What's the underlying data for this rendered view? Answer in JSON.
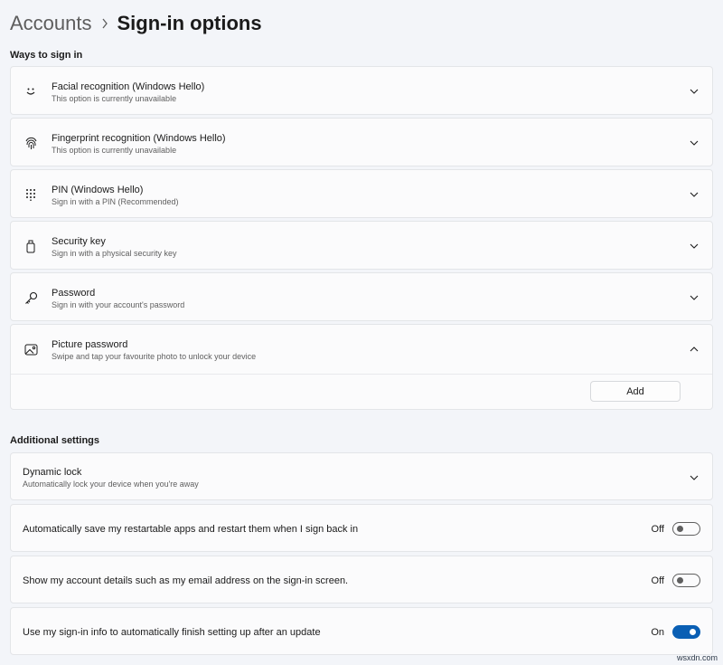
{
  "breadcrumb": {
    "parent": "Accounts",
    "current": "Sign-in options"
  },
  "ways_section": {
    "title": "Ways to sign in",
    "items": [
      {
        "title": "Facial recognition (Windows Hello)",
        "subtitle": "This option is currently unavailable",
        "icon": "face-icon"
      },
      {
        "title": "Fingerprint recognition (Windows Hello)",
        "subtitle": "This option is currently unavailable",
        "icon": "fingerprint-icon"
      },
      {
        "title": "PIN (Windows Hello)",
        "subtitle": "Sign in with a PIN (Recommended)",
        "icon": "keypad-icon"
      },
      {
        "title": "Security key",
        "subtitle": "Sign in with a physical security key",
        "icon": "usb-key-icon"
      },
      {
        "title": "Password",
        "subtitle": "Sign in with your account's password",
        "icon": "key-icon"
      }
    ],
    "picture_password": {
      "title": "Picture password",
      "subtitle": "Swipe and tap your favourite photo to unlock your device",
      "icon": "picture-icon",
      "add_label": "Add"
    }
  },
  "additional_section": {
    "title": "Additional settings",
    "dynamic_lock": {
      "title": "Dynamic lock",
      "subtitle": "Automatically lock your device when you're away"
    },
    "toggles": [
      {
        "label": "Automatically save my restartable apps and restart them when I sign back in",
        "state": "Off"
      },
      {
        "label": "Show my account details such as my email address on the sign-in screen.",
        "state": "Off"
      },
      {
        "label": "Use my sign-in info to automatically finish setting up after an update",
        "state": "On"
      }
    ]
  },
  "watermark": "wsxdn.com",
  "colors": {
    "accent": "#0a5fb4",
    "background": "#f3f5f9",
    "card": "#fbfbfc"
  }
}
